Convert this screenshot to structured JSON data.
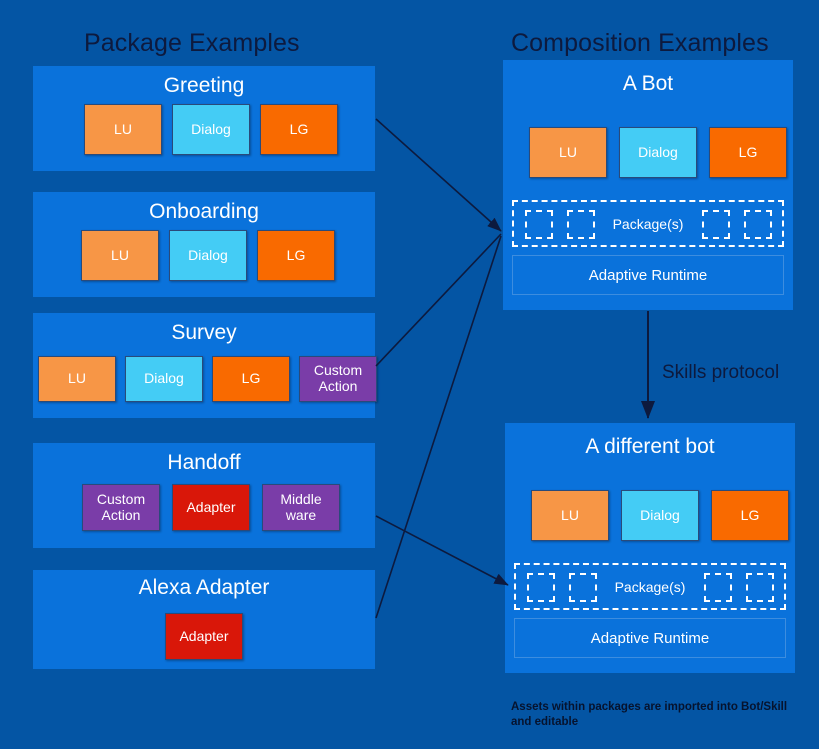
{
  "headings": {
    "packages": "Package Examples",
    "compositions": "Composition Examples"
  },
  "packages": [
    {
      "title": "Greeting",
      "items": [
        {
          "label": "LU",
          "kind": "lu"
        },
        {
          "label": "Dialog",
          "kind": "dialog"
        },
        {
          "label": "LG",
          "kind": "lg"
        }
      ]
    },
    {
      "title": "Onboarding",
      "items": [
        {
          "label": "LU",
          "kind": "lu"
        },
        {
          "label": "Dialog",
          "kind": "dialog"
        },
        {
          "label": "LG",
          "kind": "lg"
        }
      ]
    },
    {
      "title": "Survey",
      "items": [
        {
          "label": "LU",
          "kind": "lu"
        },
        {
          "label": "Dialog",
          "kind": "dialog"
        },
        {
          "label": "LG",
          "kind": "lg"
        },
        {
          "label": "Custom\nAction",
          "kind": "custom"
        }
      ]
    },
    {
      "title": "Handoff",
      "items": [
        {
          "label": "Custom\nAction",
          "kind": "custom"
        },
        {
          "label": "Adapter",
          "kind": "adapter"
        },
        {
          "label": "Middle\nware",
          "kind": "middleware"
        }
      ]
    },
    {
      "title": "Alexa Adapter",
      "items": [
        {
          "label": "Adapter",
          "kind": "adapter"
        }
      ]
    }
  ],
  "compositions": [
    {
      "title": "A Bot",
      "items": [
        {
          "label": "LU",
          "kind": "lu"
        },
        {
          "label": "Dialog",
          "kind": "dialog"
        },
        {
          "label": "LG",
          "kind": "lg"
        }
      ],
      "packages_label": "Package(s)",
      "package_slot_count": 4,
      "runtime_label": "Adaptive Runtime"
    },
    {
      "title": "A different bot",
      "items": [
        {
          "label": "LU",
          "kind": "lu"
        },
        {
          "label": "Dialog",
          "kind": "dialog"
        },
        {
          "label": "LG",
          "kind": "lg"
        }
      ],
      "packages_label": "Package(s)",
      "package_slot_count": 4,
      "runtime_label": "Adaptive Runtime"
    }
  ],
  "connector_label": "Skills protocol",
  "footnote": "Assets within packages are imported into Bot/Skill and editable",
  "colors": {
    "page_background": "#0455a4",
    "panel_background": "#0a72db",
    "lu": "#f79646",
    "dialog": "#44ccf5",
    "lg": "#f96a00",
    "custom_action": "#7a3da8",
    "adapter": "#d91709",
    "middleware": "#7a3da8",
    "heading_text": "#0d1a3e",
    "panel_text": "#ffffff",
    "connector": "#0d1a3e"
  }
}
